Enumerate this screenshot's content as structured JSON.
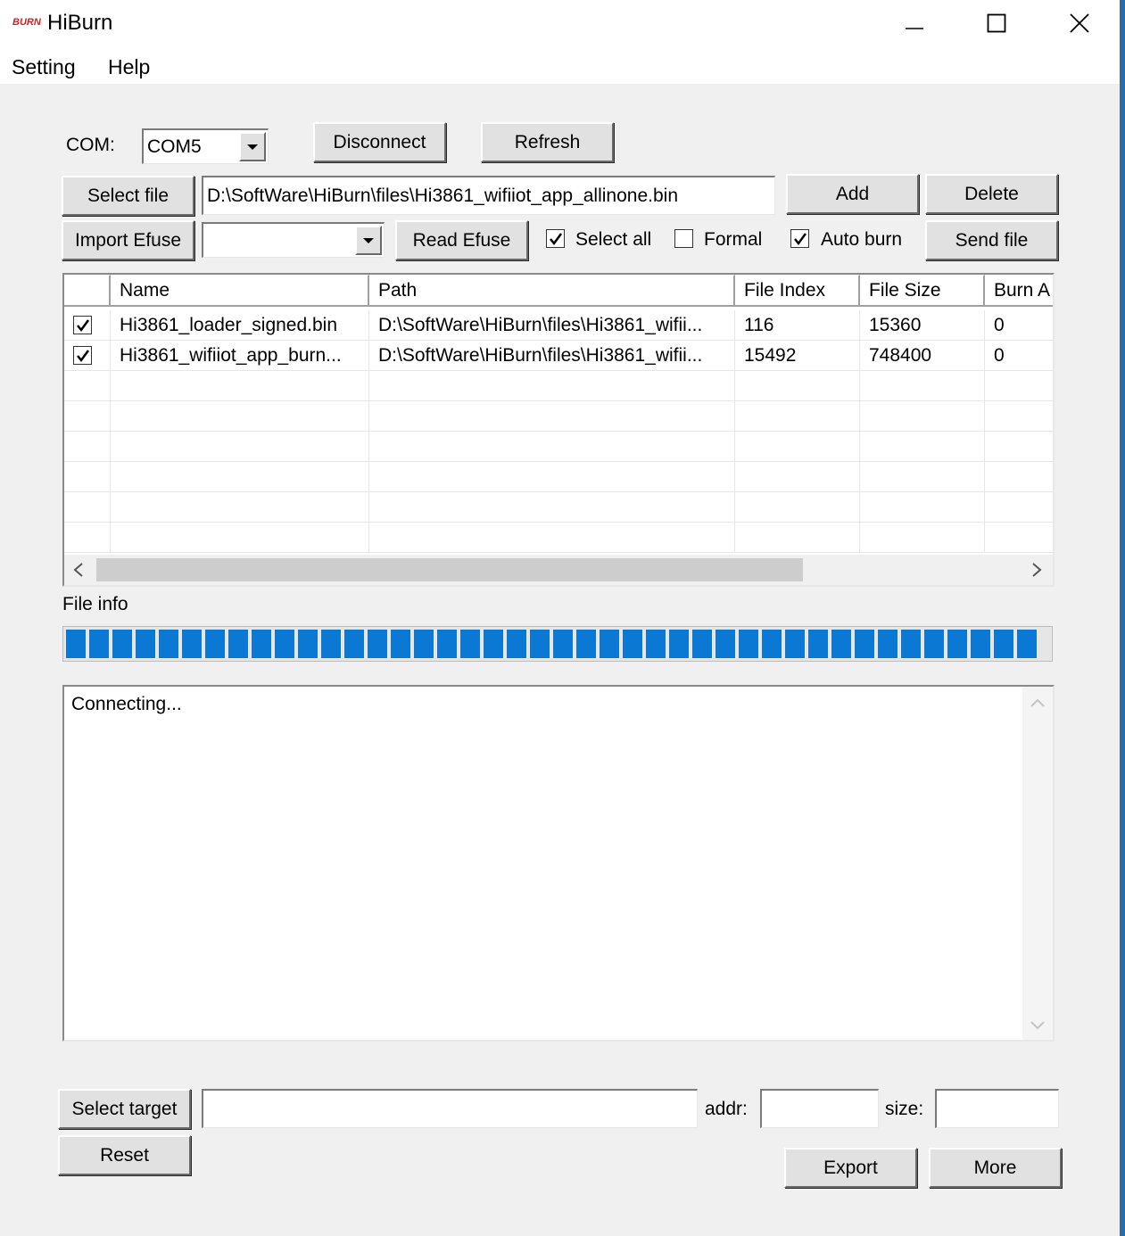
{
  "window": {
    "logo_text": "BURN",
    "title": "HiBurn",
    "controls": {
      "minimize": "—",
      "maximize": "☐",
      "close": "✕"
    }
  },
  "menu": {
    "items": [
      "Setting",
      "Help"
    ]
  },
  "com": {
    "label": "COM:",
    "selected": "COM5",
    "disconnect_label": "Disconnect",
    "refresh_label": "Refresh"
  },
  "file_row": {
    "select_file_label": "Select file",
    "path_value": "D:\\SoftWare\\HiBurn\\files\\Hi3861_wifiiot_app_allinone.bin",
    "add_label": "Add",
    "delete_label": "Delete"
  },
  "efuse_row": {
    "import_efuse_label": "Import Efuse",
    "efuse_selected": "",
    "read_efuse_label": "Read Efuse",
    "select_all": {
      "label": "Select all",
      "checked": true
    },
    "formal": {
      "label": "Formal",
      "checked": false
    },
    "auto_burn": {
      "label": "Auto burn",
      "checked": true
    },
    "send_file_label": "Send file"
  },
  "file_list": {
    "columns": [
      "",
      "Name",
      "Path",
      "File Index",
      "File Size",
      "Burn A"
    ],
    "rows": [
      {
        "checked": true,
        "name": "Hi3861_loader_signed.bin",
        "path": "D:\\SoftWare\\HiBurn\\files\\Hi3861_wifii...",
        "file_index": "116",
        "file_size": "15360",
        "burn_addr": "0"
      },
      {
        "checked": true,
        "name": "Hi3861_wifiiot_app_burn...",
        "path": "D:\\SoftWare\\HiBurn\\files\\Hi3861_wifii...",
        "file_index": "15492",
        "file_size": "748400",
        "burn_addr": "0"
      }
    ]
  },
  "file_info_label": "File info",
  "progress": {
    "fraction": 1.0,
    "color": "#0b78d4"
  },
  "log": {
    "text": "Connecting..."
  },
  "target": {
    "select_target_label": "Select target",
    "target_value": "",
    "addr_label": "addr:",
    "addr_value": "",
    "size_label": "size:",
    "size_value": ""
  },
  "bottom": {
    "reset_label": "Reset",
    "export_label": "Export",
    "more_label": "More"
  }
}
